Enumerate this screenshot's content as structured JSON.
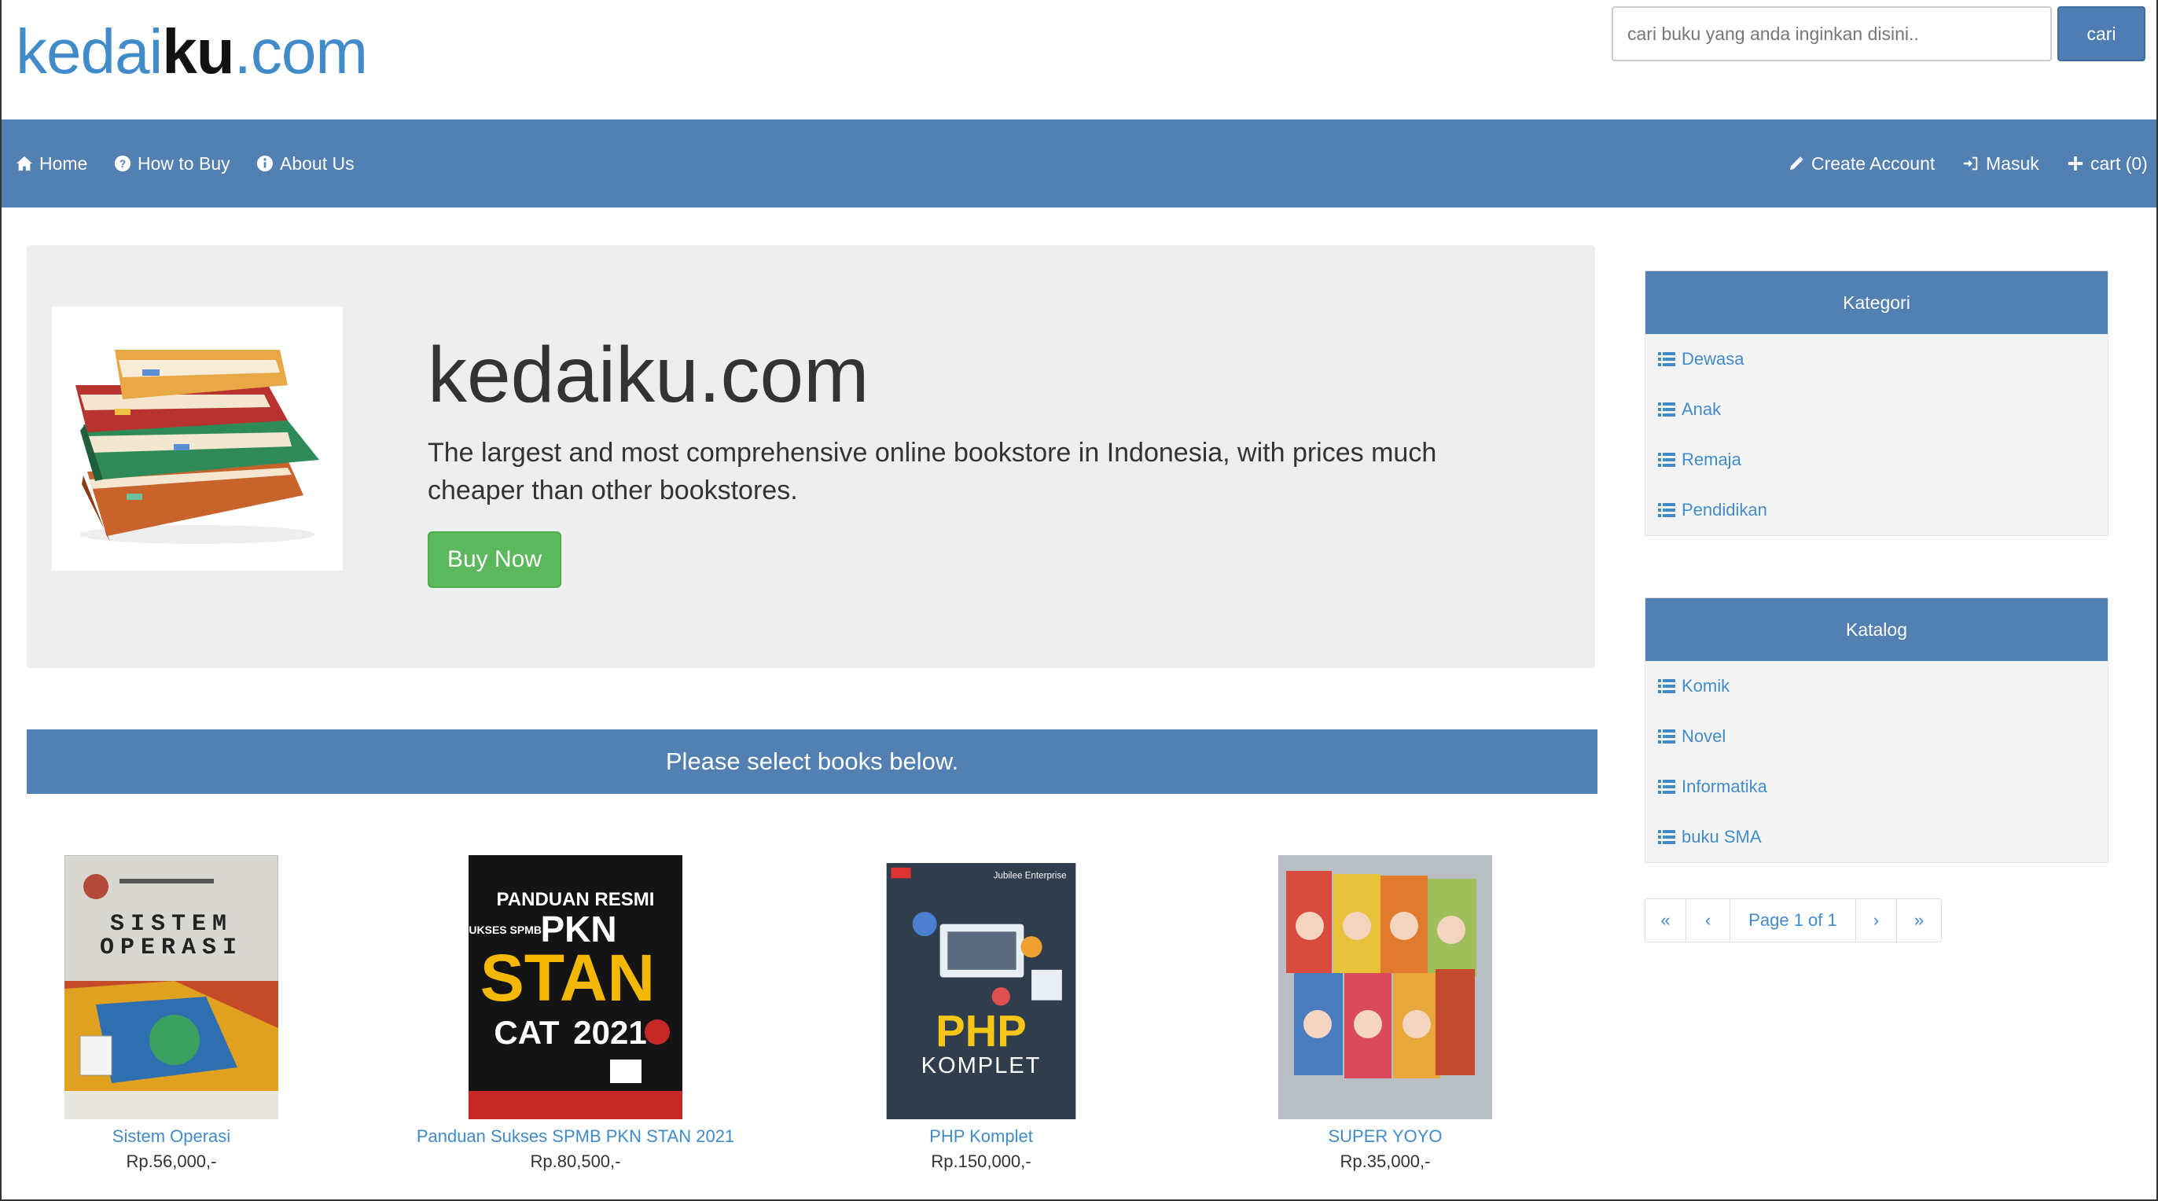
{
  "header": {
    "logo_pre": "kedai",
    "logo_bold": "ku",
    "logo_post": ".com",
    "search_placeholder": "cari buku yang anda inginkan disini..",
    "search_button": "cari"
  },
  "nav": {
    "home": "Home",
    "how_to_buy": "How to Buy",
    "about_us": "About Us",
    "create_account": "Create Account",
    "login": "Masuk",
    "cart": "cart (0)"
  },
  "jumbotron": {
    "title": "kedaiku.com",
    "description": "The largest and most comprehensive online bookstore in Indonesia, with prices much cheaper than other bookstores.",
    "button": "Buy Now"
  },
  "banner": "Please select books below.",
  "products": [
    {
      "title": "Sistem Operasi",
      "price": "Rp.56,000,-",
      "cover_text": [
        "SISTEM",
        "OPERASI"
      ]
    },
    {
      "title": "Panduan Sukses SPMB PKN STAN 2021",
      "price": "Rp.80,500,-",
      "cover_text": [
        "PANDUAN RESMI",
        "SUKSES SPMB",
        "PKN",
        "STAN",
        "CAT",
        "2021"
      ]
    },
    {
      "title": "PHP Komplet",
      "price": "Rp.150,000,-",
      "cover_text": [
        "Jubilee Enterprise",
        "PHP",
        "KOMPLET"
      ]
    },
    {
      "title": "SUPER YOYO",
      "price": "Rp.35,000,-",
      "cover_text": []
    }
  ],
  "kategori": {
    "heading": "Kategori",
    "items": [
      "Dewasa",
      "Anak",
      "Remaja",
      "Pendidikan"
    ]
  },
  "katalog": {
    "heading": "Katalog",
    "items": [
      "Komik",
      "Novel",
      "Informatika",
      "buku SMA"
    ]
  },
  "pagination": {
    "first": "«",
    "prev": "‹",
    "label": "Page 1 of 1",
    "next": "›",
    "last": "»"
  },
  "colors": {
    "primary": "#5380b3",
    "link": "#428bca",
    "success": "#5cb85c",
    "jumbotron_bg": "#eeeeee"
  }
}
